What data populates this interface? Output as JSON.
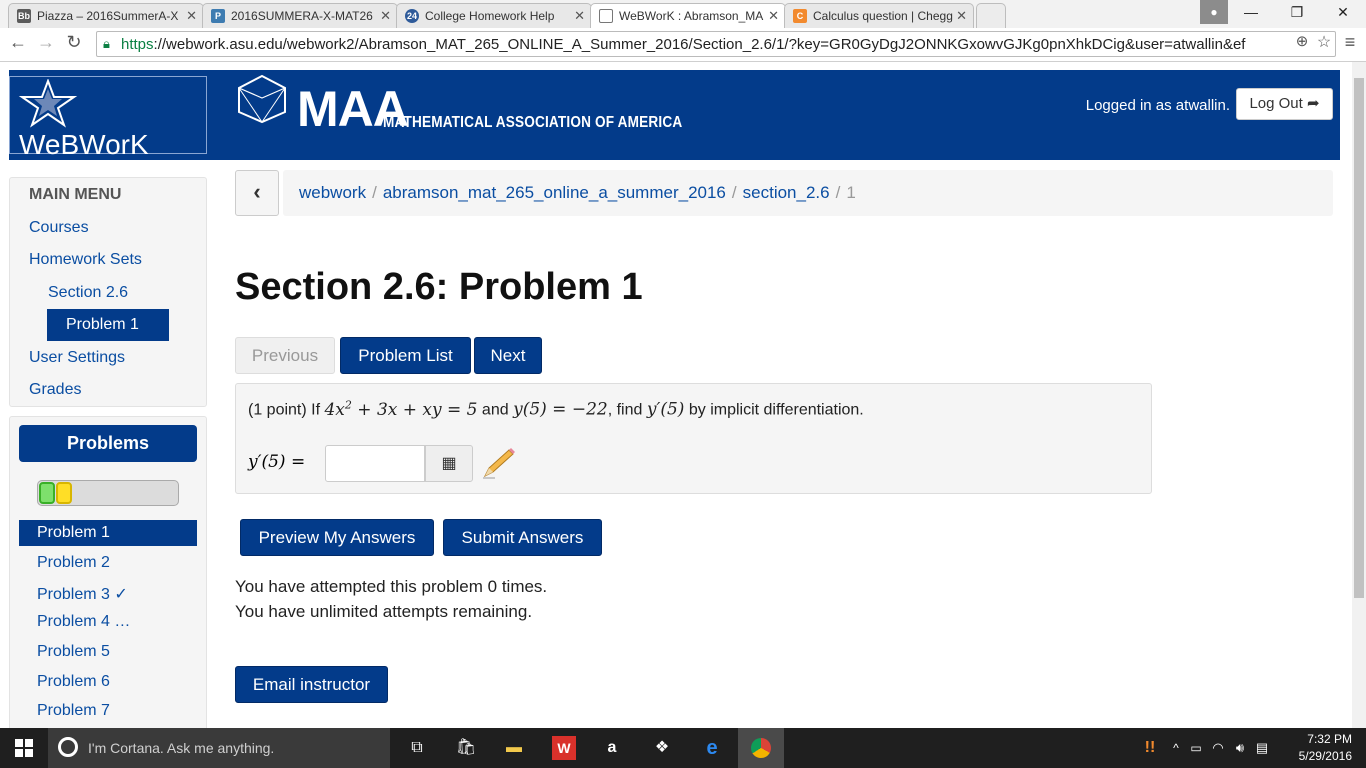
{
  "browser": {
    "tabs": [
      {
        "label": "Piazza – 2016SummerA-X",
        "icon": "blackboard-icon",
        "icon_text": "Bb",
        "icon_color": "#5b5b5b"
      },
      {
        "label": "2016SUMMERA-X-MAT26",
        "icon": "piazza-icon",
        "icon_text": "P",
        "icon_color": "#3e7cb1"
      },
      {
        "label": "College Homework Help",
        "icon": "badge-24-icon",
        "icon_text": "24",
        "icon_color": "#2f5b9a"
      },
      {
        "label": "WeBWorK : Abramson_MA",
        "icon": "page-icon",
        "icon_text": "",
        "icon_color": "#ffffff"
      },
      {
        "label": "Calculus question | Chegg",
        "icon": "chegg-icon",
        "icon_text": "C",
        "icon_color": "#f28a2e"
      }
    ],
    "url_scheme": "https",
    "url_rest": "://webwork.asu.edu/webwork2/Abramson_MAT_265_ONLINE_A_Summer_2016/Section_2.6/1/?key=GR0GyDgJ2ONNKGxowvGJKg0pnXhkDCig&user=atwallin&ef"
  },
  "header": {
    "site_name": "WeBWorK",
    "maa_logo": "MAA",
    "maa_subtitle": "MATHEMATICAL ASSOCIATION OF AMERICA",
    "logged_in": "Logged in as atwallin.",
    "logout_label": "Log Out"
  },
  "main_menu": {
    "title": "MAIN MENU",
    "courses": "Courses",
    "homework_sets": "Homework Sets",
    "section": "Section 2.6",
    "problem": "Problem 1",
    "user_settings": "User Settings",
    "grades": "Grades"
  },
  "problems_panel": {
    "title": "Problems",
    "progress_correct": 1,
    "progress_partial": 1,
    "items": [
      "Problem 1",
      "Problem 2",
      "Problem 3 ✓",
      "Problem 4 …",
      "Problem 5",
      "Problem 6",
      "Problem 7"
    ]
  },
  "breadcrumb": {
    "items": [
      "webwork",
      "abramson_mat_265_online_a_summer_2016",
      "section_2.6"
    ],
    "current": "1",
    "separator": "/"
  },
  "page_title": "Section 2.6: Problem 1",
  "nav": {
    "previous": "Previous",
    "problem_list": "Problem List",
    "next": "Next"
  },
  "problem": {
    "points": "(1 point) If ",
    "and": " and ",
    "find": ", find ",
    "by": " by implicit differentiation.",
    "answer_label": "y′(5) =",
    "answer_value": ""
  },
  "actions": {
    "preview": "Preview My Answers",
    "submit": "Submit Answers",
    "email": "Email instructor"
  },
  "messages": {
    "attempts": "You have attempted this problem 0 times.",
    "remaining": "You have unlimited attempts remaining."
  },
  "taskbar": {
    "cortana": "I'm Cortana. Ask me anything.",
    "time": "7:32 PM",
    "date": "5/29/2016"
  },
  "colors": {
    "brand": "#033b8a",
    "link": "#0b4ea2"
  }
}
